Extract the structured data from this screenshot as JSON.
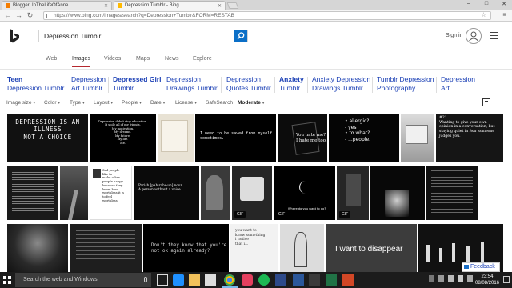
{
  "browser": {
    "tabs": [
      {
        "title": "Blogger: InTheLifeOfAnne",
        "active": false,
        "favicon_color": "#f57d00"
      },
      {
        "title": "Depression Tumblr - Bing",
        "active": true,
        "favicon_color": "#ffb900"
      }
    ],
    "address": "https://www.bing.com/images/search?q=Depression+Tumblr&FORM=RESTAB",
    "window_buttons": [
      "–",
      "□",
      "✕"
    ]
  },
  "bing": {
    "query": "Depression Tumblr",
    "signin": "Sign in",
    "nav_tabs": [
      {
        "label": "Web",
        "active": false
      },
      {
        "label": "Images",
        "active": true
      },
      {
        "label": "Videos",
        "active": false
      },
      {
        "label": "Maps",
        "active": false
      },
      {
        "label": "News",
        "active": false
      },
      {
        "label": "Explore",
        "active": false
      }
    ],
    "related": [
      {
        "line1": "Teen",
        "line2": "Depression Tumblr",
        "bold": "Teen"
      },
      {
        "line1": "Depression",
        "line2": "Art Tumblr",
        "bold": "Art"
      },
      {
        "line1": "Depressed Girl",
        "line2": "Tumblr",
        "bold": "Depressed Girl"
      },
      {
        "line1": "Depression",
        "line2": "Drawings Tumblr",
        "bold": "Drawings"
      },
      {
        "line1": "Depression",
        "line2": "Quotes Tumblr",
        "bold": "Quotes"
      },
      {
        "line1": "Anxiety",
        "line2": "Tumblr",
        "bold": "Anxiety"
      },
      {
        "line1": "Anxiety Depression",
        "line2": "Drawings Tumblr",
        "bold": "Anxiety"
      },
      {
        "line1": "Tumblr Depression",
        "line2": "Photography",
        "bold": "Photography"
      },
      {
        "line1": "Depression",
        "line2": "Art",
        "bold": "Art"
      }
    ],
    "filters": [
      "Image size",
      "Color",
      "Type",
      "Layout",
      "People",
      "Date",
      "License",
      "SafeSearch",
      "Moderate"
    ],
    "feedback": "Feedback"
  },
  "images": {
    "row1": [
      {
        "text": "DEPRESSION IS AN\nILLNESS\nNOT A CHOICE",
        "bg": "#111111"
      },
      {
        "text": "Depression didn't stop education.\nIt stole all of my friends.\nMy motivation.\nMy dreams.\nMy future.\nMy life.\nMe.",
        "bg": "#000000"
      },
      {
        "text": "",
        "bg": "#e8e2d4"
      },
      {
        "text": "I need to be saved from myself\nsometimes.",
        "bg": "#000000"
      },
      {
        "text": "You hate me?\nI hate me too.",
        "bg": "#0c0c0c"
      },
      {
        "text": "• allergic?\n- yes\n• to what?\n- ...people.",
        "bg": "#050505"
      },
      {
        "text": "",
        "bg": "#c8c8c8"
      },
      {
        "text": "#21\nWanting to give your own\nopinion in a conversation, but\nstaying quiet in fear someone\njudges you.",
        "bg": "#151515"
      }
    ],
    "row2": [
      {
        "text": "",
        "bg": "#1a1a1a"
      },
      {
        "text": "",
        "bg": "#2e2e2e"
      },
      {
        "text": "Sad people\nlike to\nmake other\npeople happy\nbecause they\nknow how\nworthless it is\nto feel\nworthless.",
        "bg": "#ffffff"
      },
      {
        "text": "Parish [pah-rahs-uh] noun\nA person without a voice.",
        "bg": "#0a0a0a"
      },
      {
        "text": "",
        "bg": "#3a3a3a"
      },
      {
        "text": "Where do you want to go?",
        "bg": "#000000"
      },
      {
        "text": "",
        "bg": "#262626"
      },
      {
        "text": "",
        "bg": "#080808"
      }
    ],
    "row3": [
      {
        "text": "",
        "bg": "#2a2a2a"
      },
      {
        "text": "",
        "bg": "#1e1e1e"
      },
      {
        "text": "Don't they know that you're\nnot ok again already?",
        "bg": "#000000"
      },
      {
        "text": "you want to\nknow something\ni notice\nthat i...",
        "bg": "#f2f2f2"
      },
      {
        "text": "",
        "bg": "#dcdcdc"
      },
      {
        "text": "I want to disappear",
        "bg": "#3c3c3c"
      },
      {
        "text": "",
        "bg": "#111111"
      }
    ],
    "gif_label": "GIF"
  },
  "taskbar": {
    "search_placeholder": "Search the web and Windows",
    "time": "23:54",
    "date": "08/08/2016"
  }
}
